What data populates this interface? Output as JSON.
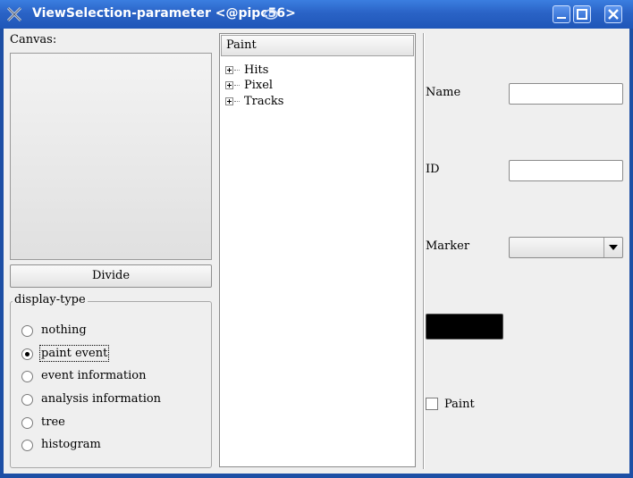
{
  "window": {
    "title": "ViewSelection-parameter <@pipc56>",
    "controls": [
      "minimize",
      "maximize",
      "close"
    ]
  },
  "left": {
    "canvas_label": "Canvas:",
    "divide_label": "Divide",
    "display_type": {
      "title": "display-type",
      "selected": "paint event",
      "options": [
        {
          "label": "nothing",
          "checked": false
        },
        {
          "label": "paint event",
          "checked": true
        },
        {
          "label": "event information",
          "checked": false
        },
        {
          "label": "analysis information",
          "checked": false
        },
        {
          "label": "tree",
          "checked": false
        },
        {
          "label": "histogram",
          "checked": false
        }
      ]
    }
  },
  "tree": {
    "header": "Paint",
    "items": [
      {
        "label": "Hits",
        "expandable": true
      },
      {
        "label": "Pixel",
        "expandable": true
      },
      {
        "label": "Tracks",
        "expandable": true
      }
    ]
  },
  "properties": {
    "name_label": "Name",
    "name_value": "",
    "id_label": "ID",
    "id_value": "",
    "marker_label": "Marker",
    "marker_value": "",
    "color": "#000000",
    "paint_label": "Paint",
    "paint_checked": false
  },
  "colors": {
    "titlebar": "#2a63c6",
    "window_bg": "#efefef",
    "frame": "#1d4fa5"
  }
}
